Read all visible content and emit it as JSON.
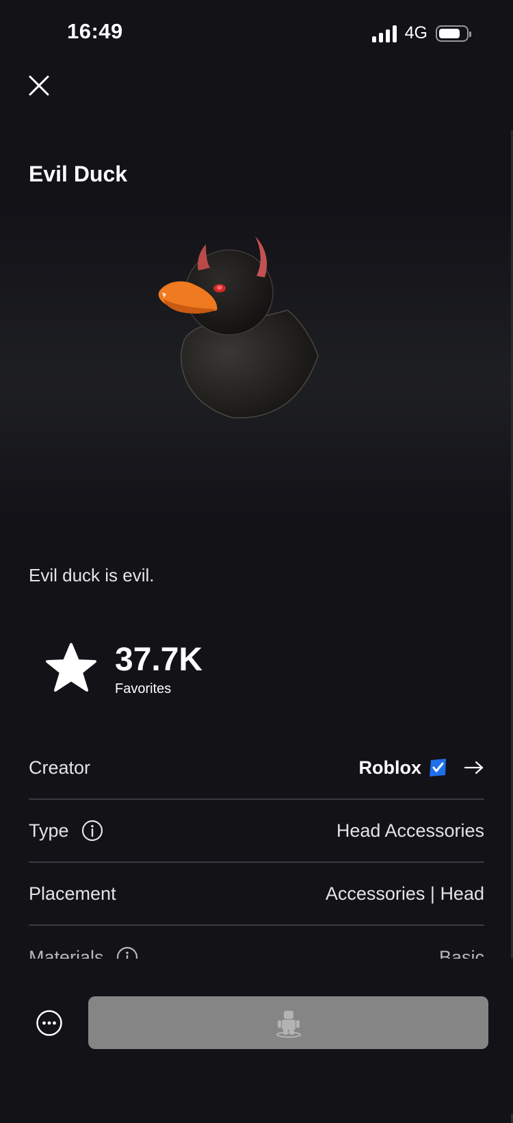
{
  "status_bar": {
    "time": "16:49",
    "network": "4G",
    "battery_level": 0.8
  },
  "item": {
    "title": "Evil Duck",
    "description": "Evil duck is evil.",
    "image_icon": "evil-duck-accessory"
  },
  "favorites": {
    "count": "37.7K",
    "label": "Favorites"
  },
  "details": {
    "creator": {
      "label": "Creator",
      "value": "Roblox"
    },
    "type": {
      "label": "Type",
      "value": "Head Accessories"
    },
    "placement": {
      "label": "Placement",
      "value": "Accessories | Head"
    },
    "materials": {
      "label": "Materials",
      "value": "Basic"
    }
  },
  "colors": {
    "background": "#121217",
    "verified": "#1f6feb",
    "try_on_button": "#858585"
  },
  "icons": [
    "close-icon",
    "star-icon",
    "info-icon",
    "verified-badge-icon",
    "arrow-right-icon",
    "more-icon",
    "avatar-icon"
  ]
}
